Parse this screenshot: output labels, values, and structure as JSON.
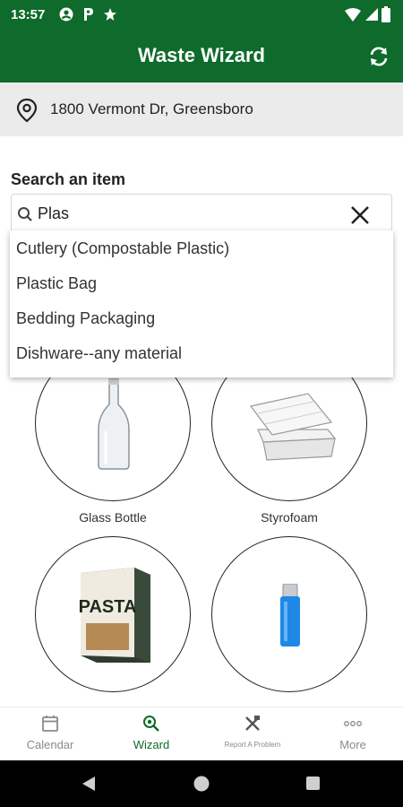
{
  "status_bar": {
    "time": "13:57",
    "icons": [
      "account-circle-icon",
      "parking-icon",
      "star-icon",
      "wifi-icon",
      "battery-icon"
    ]
  },
  "app_bar": {
    "title": "Waste Wizard",
    "refresh_icon": "refresh-icon"
  },
  "location": {
    "address": "1800 Vermont Dr, Greensboro",
    "icon": "location-pin-icon"
  },
  "search": {
    "label": "Search an item",
    "value": "Plas",
    "suggestions": [
      "Cutlery (Compostable Plastic)",
      "Plastic Bag",
      "Bedding Packaging",
      "Dishware--any material"
    ]
  },
  "items": [
    {
      "caption": "Glass Bottle",
      "image": "glass-bottle"
    },
    {
      "caption": "Styrofoam",
      "image": "styrofoam-container"
    },
    {
      "caption": "",
      "image": "pasta-box",
      "image_text": "PASTA"
    },
    {
      "caption": "",
      "image": "blue-lighter"
    }
  ],
  "bottom_nav": [
    {
      "label": "Calendar",
      "icon": "calendar-icon",
      "active": false
    },
    {
      "label": "Wizard",
      "icon": "wizard-search-icon",
      "active": true
    },
    {
      "label": "Report A Problem",
      "icon": "tools-icon",
      "active": false
    },
    {
      "label": "More",
      "icon": "more-dots-icon",
      "active": false
    }
  ],
  "colors": {
    "primary": "#0e6b2b",
    "address_bg": "#ebebeb",
    "nav_inactive": "#8a8a8a"
  }
}
